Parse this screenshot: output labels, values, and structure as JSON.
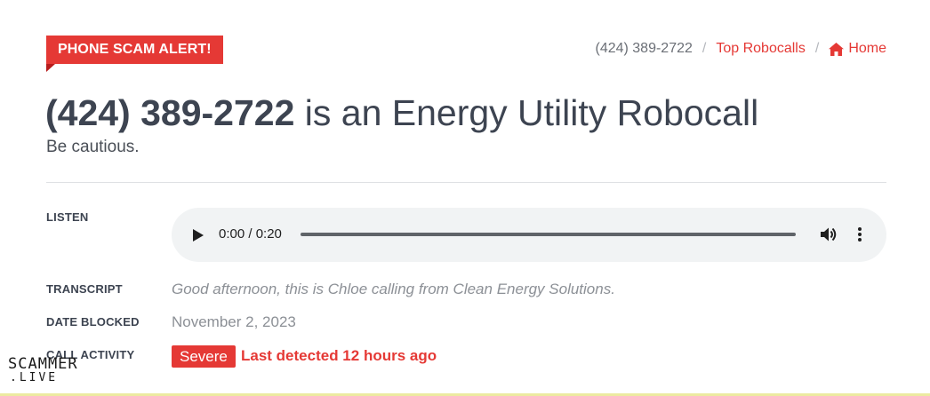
{
  "alert": {
    "label": "PHONE SCAM ALERT!"
  },
  "breadcrumb": {
    "current": "(424) 389-2722",
    "separator": "/",
    "top_robocalls": "Top Robocalls",
    "home": "Home"
  },
  "headline": {
    "phone": "(424) 389-2722",
    "rest": " is an Energy Utility Robocall",
    "subtitle": "Be cautious."
  },
  "details": {
    "listen_label": "LISTEN",
    "audio": {
      "time": "0:00 / 0:20",
      "progress": 0
    },
    "transcript_label": "TRANSCRIPT",
    "transcript": "Good afternoon, this is Chloe calling from Clean Energy Solutions.",
    "date_label": "DATE BLOCKED",
    "date": "November 2, 2023",
    "activity_label": "CALL ACTIVITY",
    "severity": "Severe",
    "last_detected": "Last detected 12 hours ago"
  },
  "watermark": {
    "line1": "SCAMMER",
    "line2": ".LIVE"
  },
  "colors": {
    "accent": "#e53935",
    "text": "#3d4451",
    "muted": "#8c9096",
    "player_bg": "#f1f3f4"
  },
  "icons": {
    "home": "home-icon",
    "play": "play-icon",
    "volume": "volume-icon",
    "more": "more-vertical-icon"
  }
}
